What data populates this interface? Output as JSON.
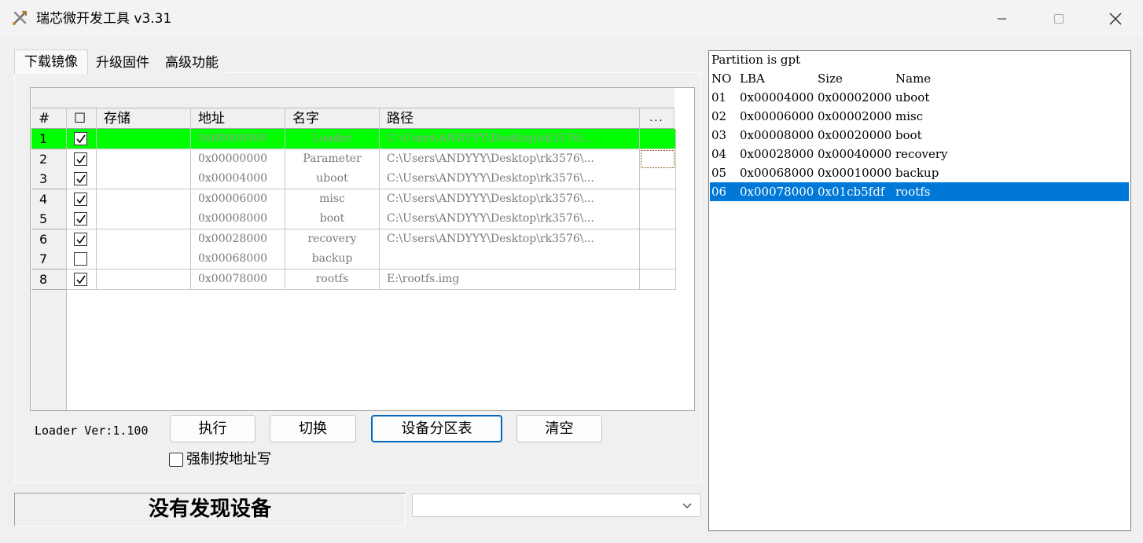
{
  "window": {
    "title": "瑞芯微开发工具 v3.31"
  },
  "tabs": [
    {
      "label": "下载镜像",
      "active": true
    },
    {
      "label": "升级固件",
      "active": false
    },
    {
      "label": "高级功能",
      "active": false
    }
  ],
  "table": {
    "headers": [
      "#",
      "☐",
      "存储",
      "地址",
      "名字",
      "路径",
      "..."
    ],
    "rows": [
      {
        "no": "1",
        "checked": true,
        "storage": "",
        "address": "0x00000000",
        "name": "Loader",
        "path": "C:\\Users\\ANDYYY\\Desktop\\rk3576\\...",
        "selected": true
      },
      {
        "no": "2",
        "checked": true,
        "storage": "",
        "address": "0x00000000",
        "name": "Parameter",
        "path": "C:\\Users\\ANDYYY\\Desktop\\rk3576\\...",
        "selected": false
      },
      {
        "no": "3",
        "checked": true,
        "storage": "",
        "address": "0x00004000",
        "name": "uboot",
        "path": "C:\\Users\\ANDYYY\\Desktop\\rk3576\\...",
        "selected": false
      },
      {
        "no": "4",
        "checked": true,
        "storage": "",
        "address": "0x00006000",
        "name": "misc",
        "path": "C:\\Users\\ANDYYY\\Desktop\\rk3576\\...",
        "selected": false
      },
      {
        "no": "5",
        "checked": true,
        "storage": "",
        "address": "0x00008000",
        "name": "boot",
        "path": "C:\\Users\\ANDYYY\\Desktop\\rk3576\\...",
        "selected": false
      },
      {
        "no": "6",
        "checked": true,
        "storage": "",
        "address": "0x00028000",
        "name": "recovery",
        "path": "C:\\Users\\ANDYYY\\Desktop\\rk3576\\...",
        "selected": false
      },
      {
        "no": "7",
        "checked": false,
        "storage": "",
        "address": "0x00068000",
        "name": "backup",
        "path": "",
        "selected": false
      },
      {
        "no": "8",
        "checked": true,
        "storage": "",
        "address": "0x00078000",
        "name": "rootfs",
        "path": "E:\\rootfs.img",
        "selected": false
      }
    ]
  },
  "loader_version": "Loader Ver:1.100",
  "buttons": {
    "run": "执行",
    "switch": "切换",
    "partition_table": "设备分区表",
    "clear": "清空"
  },
  "force_address_write": {
    "label": "强制按地址写",
    "checked": false
  },
  "status": "没有发现设备",
  "combo": {
    "value": ""
  },
  "log": {
    "title": "Partition is gpt",
    "header": [
      "NO",
      "LBA",
      "Size",
      "Name"
    ],
    "rows": [
      {
        "no": "01",
        "lba": "0x00004000",
        "size": "0x00002000",
        "name": "uboot",
        "selected": false
      },
      {
        "no": "02",
        "lba": "0x00006000",
        "size": "0x00002000",
        "name": "misc",
        "selected": false
      },
      {
        "no": "03",
        "lba": "0x00008000",
        "size": "0x00020000",
        "name": "boot",
        "selected": false
      },
      {
        "no": "04",
        "lba": "0x00028000",
        "size": "0x00040000",
        "name": "recovery",
        "selected": false
      },
      {
        "no": "05",
        "lba": "0x00068000",
        "size": "0x00010000",
        "name": "backup",
        "selected": false
      },
      {
        "no": "06",
        "lba": "0x00078000",
        "size": "0x01cb5fdf",
        "name": "rootfs",
        "selected": true
      }
    ]
  },
  "colors": {
    "selected_row": "#00ff00",
    "log_selection": "#0078d7",
    "primary_button_border": "#0067c0"
  },
  "icons": [
    "app-tools-icon",
    "minimize-icon",
    "maximize-icon",
    "close-icon",
    "checkbox-icon",
    "dropdown-arrow-icon"
  ]
}
